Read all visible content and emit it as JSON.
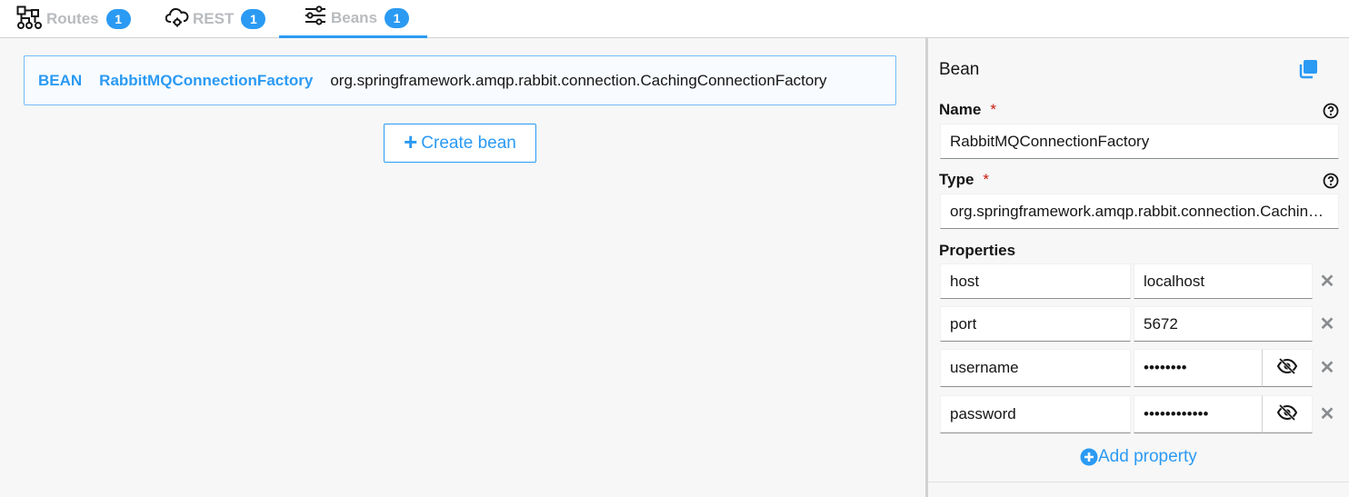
{
  "tabs": [
    {
      "label": "Routes",
      "count": "1",
      "icon": "route-graph-icon"
    },
    {
      "label": "REST",
      "count": "1",
      "icon": "cloud-gear-icon"
    },
    {
      "label": "Beans",
      "count": "1",
      "icon": "sliders-icon"
    }
  ],
  "beans": [
    {
      "kind": "BEAN",
      "name": "RabbitMQConnectionFactory",
      "type": "org.springframework.amqp.rabbit.connection.CachingConnectionFactory"
    }
  ],
  "create_bean_label": "Create bean",
  "details": {
    "title": "Bean",
    "name_label": "Name",
    "name_value": "RabbitMQConnectionFactory",
    "type_label": "Type",
    "type_value": "org.springframework.amqp.rabbit.connection.CachingConnectionFactory",
    "required_mark": "*",
    "properties_label": "Properties",
    "properties": [
      {
        "key": "host",
        "value": "localhost"
      },
      {
        "key": "port",
        "value": "5672"
      },
      {
        "key": "username",
        "value": "••••••••"
      },
      {
        "key": "password",
        "value": "••••••••••••"
      }
    ],
    "add_property_label": "Add property"
  },
  "colors": {
    "accent": "#2b9af3",
    "danger": "#c9190b",
    "muted": "#b8bbbe"
  }
}
